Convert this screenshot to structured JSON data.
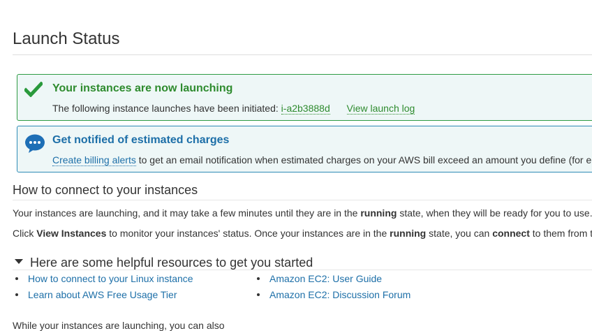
{
  "page": {
    "title": "Launch Status"
  },
  "success_box": {
    "title": "Your instances are now launching",
    "text_prefix": "The following instance launches have been initiated:",
    "instance_id": "i-a2b3888d",
    "log_link": "View launch log",
    "icon": "checkmark-icon",
    "color": "#2d9b43"
  },
  "billing_box": {
    "title": "Get notified of estimated charges",
    "link": "Create billing alerts",
    "text_suffix": "to get an email notification when estimated charges on your AWS bill exceed an amount you define (for e",
    "icon": "chat-bubble-icon",
    "color": "#2e8bb6"
  },
  "connect": {
    "heading": "How to connect to your instances",
    "p1_a": "Your instances are launching, and it may take a few minutes until they are in the",
    "p1_bold": "running",
    "p1_b": "state, when they will be ready for you to use.",
    "p2_a": "Click",
    "p2_bold1": "View Instances",
    "p2_b": "to monitor your instances' status. Once your instances are in the",
    "p2_bold2": "running",
    "p2_c": "state, you can",
    "p2_bold3": "connect",
    "p2_d": "to them from t"
  },
  "resources": {
    "heading": "Here are some helpful resources to get you started",
    "left": [
      "How to connect to your Linux instance",
      "Learn about AWS Free Usage Tier"
    ],
    "right": [
      "Amazon EC2: User Guide",
      "Amazon EC2: Discussion Forum"
    ]
  },
  "footer_partial": "While your instances are launching, you can also"
}
